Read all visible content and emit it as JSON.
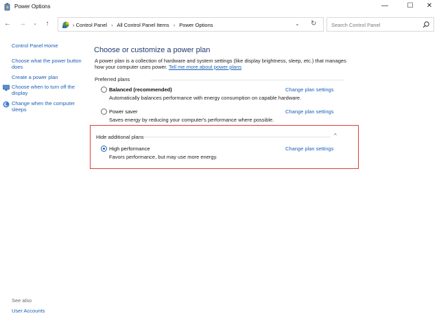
{
  "window": {
    "title": "Power Options",
    "min_glyph": "—",
    "max_glyph": "☐",
    "close_glyph": "✕"
  },
  "nav": {
    "back_glyph": "←",
    "forward_glyph": "→",
    "recent_glyph": "⌄",
    "up_glyph": "↑"
  },
  "address": {
    "crumbs": [
      "Control Panel",
      "All Control Panel Items",
      "Power Options"
    ],
    "separator": "›",
    "dropdown_glyph": "⌄",
    "refresh_glyph": "↻"
  },
  "search": {
    "placeholder": "Search Control Panel"
  },
  "sidebar": {
    "home": "Control Panel Home",
    "links": [
      "Choose what the power button does",
      "Create a power plan",
      "Choose when to turn off the display",
      "Change when the computer sleeps"
    ],
    "see_also": "See also",
    "user_accounts": "User Accounts"
  },
  "main": {
    "title": "Choose or customize a power plan",
    "intro_text": "A power plan is a collection of hardware and system settings (like display brightness, sleep, etc.) that manages how your computer uses power. ",
    "intro_link": "Tell me more about power plans",
    "preferred_label": "Preferred plans",
    "plans": [
      {
        "name": "Balanced (recommended)",
        "description": "Automatically balances performance with energy consumption on capable hardware.",
        "change": "Change plan settings",
        "selected": false
      },
      {
        "name": "Power saver",
        "description": "Saves energy by reducing your computer's performance where possible.",
        "change": "Change plan settings",
        "selected": false
      }
    ],
    "hide_label": "Hide additional plans",
    "hide_chevron": "^",
    "additional_plans": [
      {
        "name": "High performance",
        "description": "Favors performance, but may use more energy.",
        "change": "Change plan settings",
        "selected": true
      }
    ]
  },
  "colors": {
    "link": "#1a5fb4",
    "title": "#1e3a6e",
    "highlight_box": "#e23b3b"
  }
}
